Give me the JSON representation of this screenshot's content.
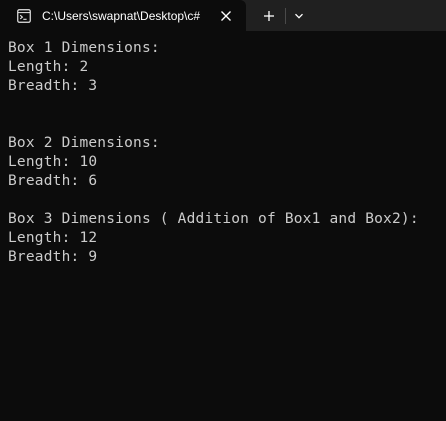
{
  "window": {
    "tab_title": "C:\\Users\\swapnat\\Desktop\\c#",
    "tab_icon": "terminal-icon",
    "close_icon": "close-icon",
    "new_tab_icon": "plus-icon",
    "dropdown_icon": "chevron-down-icon"
  },
  "console": {
    "lines": [
      "Box 1 Dimensions:",
      "Length: 2",
      "Breadth: 3",
      "",
      "",
      "Box 2 Dimensions:",
      "Length: 10",
      "Breadth: 6",
      "",
      "Box 3 Dimensions ( Addition of Box1 and Box2):",
      "Length: 12",
      "Breadth: 9"
    ]
  },
  "colors": {
    "background": "#0c0c0c",
    "titlebar": "#202020",
    "text": "#cccccc"
  }
}
